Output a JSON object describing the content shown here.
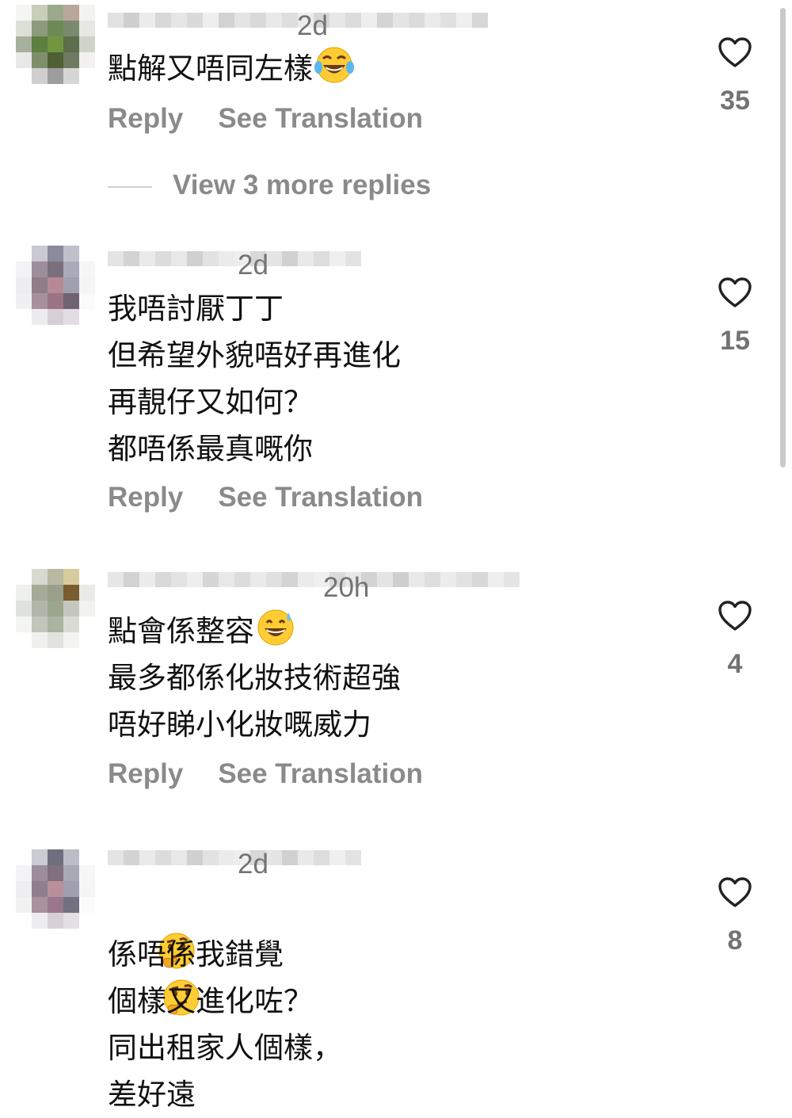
{
  "comments": [
    {
      "timestamp": "2d",
      "lines": [
        "點解又唔同左樣"
      ],
      "emoji": [
        "face-with-tears-of-joy"
      ],
      "reply_label": "Reply",
      "translate_label": "See Translation",
      "likes": "35",
      "view_more": "View 3 more replies"
    },
    {
      "timestamp": "2d",
      "lines": [
        "我唔討厭丁丁",
        "但希望外貌唔好再進化",
        "再靚仔又如何？",
        "都唔係最真嘅你"
      ],
      "reply_label": "Reply",
      "translate_label": "See Translation",
      "likes": "15"
    },
    {
      "timestamp": "20h",
      "lines": [
        "點會係整容",
        "最多都係化妝技術超強",
        "唔好睇小化妝嘅威力"
      ],
      "emoji": [
        "grinning-face-with-sweat"
      ],
      "reply_label": "Reply",
      "translate_label": "See Translation",
      "likes": "4"
    },
    {
      "timestamp": "2d",
      "lines": [
        "係唔係我錯覺",
        "個樣又進化咗？",
        "同出租家人個樣，",
        "差好遠"
      ],
      "emoji": [
        "thinking-face",
        "thinking-face"
      ],
      "likes": "8"
    }
  ],
  "colors": {
    "text": "#111111",
    "muted": "#737373",
    "action": "#8a8a8a",
    "heart_stroke": "#222222"
  },
  "icons": {
    "like": "heart-outline-icon"
  }
}
